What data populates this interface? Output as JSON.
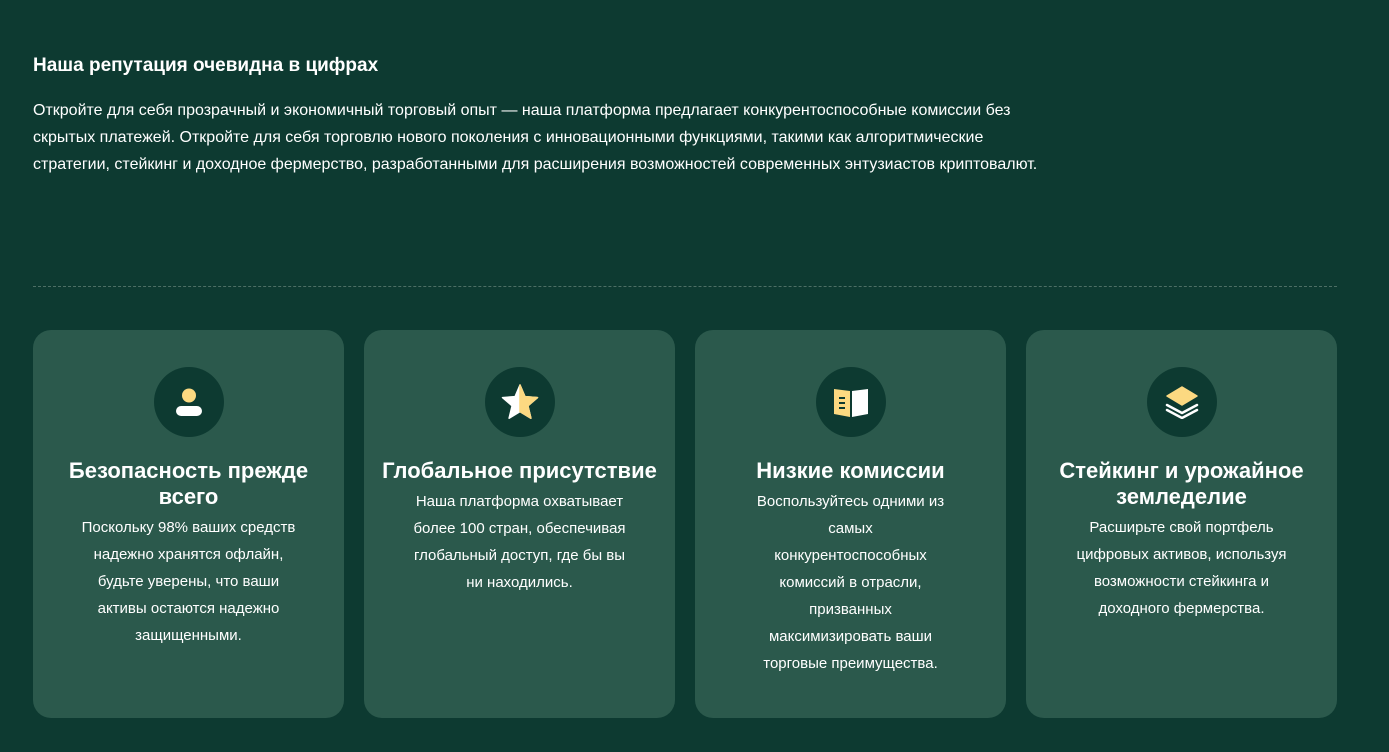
{
  "section": {
    "title": "Наша репутация очевидна в цифрах",
    "description": "Откройте для себя прозрачный и экономичный торговый опыт — наша платформа предлагает конкурентоспособные комиссии без скрытых платежей. Откройте для себя торговлю нового поколения с инновационными функциями, такими как алгоритмические стратегии, стейкинг и доходное фермерство, разработанными для расширения возможностей современных энтузиастов криптовалют."
  },
  "colors": {
    "background": "#0d3a31",
    "card": "#2b594c",
    "icon_accent": "#fcd981"
  },
  "cards": [
    {
      "icon": "user-icon",
      "title": "Безопасность прежде всего",
      "text": "Поскольку 98% ваших средств надежно хранятся офлайн, будьте уверены, что ваши активы остаются надежно защищенными."
    },
    {
      "icon": "star-icon",
      "title": "Глобальное присутствие",
      "text": "Наша платформа охватывает более 100 стран, обеспечивая глобальный доступ, где бы вы ни находились."
    },
    {
      "icon": "book-icon",
      "title": "Низкие комиссии",
      "text": "Воспользуйтесь одними из самых конкурентоспособных комиссий в отрасли, призванных максимизировать ваши торговые преимущества."
    },
    {
      "icon": "layers-icon",
      "title": "Стейкинг и урожайное земледелие",
      "text": "Расширьте свой портфель цифровых активов, используя возможности стейкинга и доходного фермерства."
    }
  ]
}
